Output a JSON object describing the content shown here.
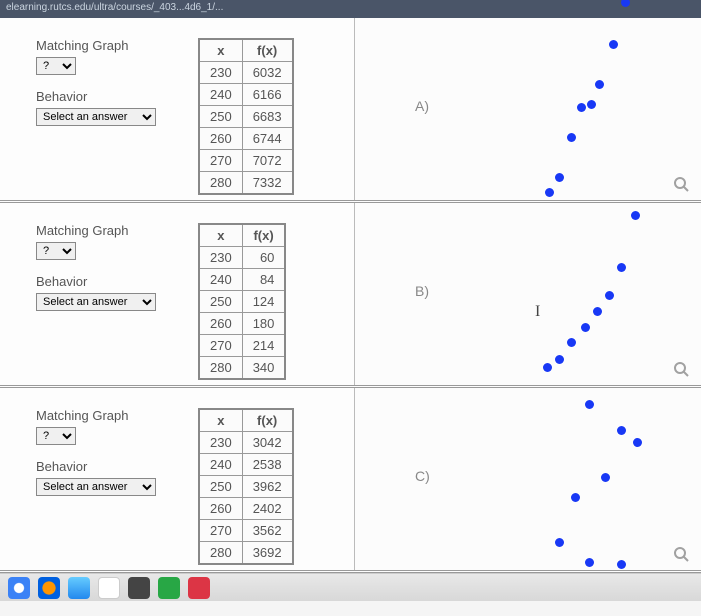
{
  "url_fragment": "elearning.rutcs.edu/ultra/courses/_403...4d6_1/...",
  "labels": {
    "matching_graph": "Matching Graph",
    "behavior": "Behavior",
    "sel_graph_placeholder": "?",
    "sel_behavior_placeholder": "Select an answer"
  },
  "table_headers": {
    "x": "x",
    "fx": "f(x)"
  },
  "rows": [
    {
      "id": "A",
      "graph_label": "A)",
      "data": [
        {
          "x": "230",
          "fx": "6032"
        },
        {
          "x": "240",
          "fx": "6166"
        },
        {
          "x": "250",
          "fx": "6683"
        },
        {
          "x": "260",
          "fx": "6744"
        },
        {
          "x": "270",
          "fx": "7072"
        },
        {
          "x": "280",
          "fx": "7332"
        }
      ],
      "dots": [
        {
          "l": 266,
          "t": -20
        },
        {
          "l": 254,
          "t": 22
        },
        {
          "l": 240,
          "t": 62
        },
        {
          "l": 232,
          "t": 82
        },
        {
          "l": 222,
          "t": 85
        },
        {
          "l": 212,
          "t": 115
        },
        {
          "l": 200,
          "t": 155
        },
        {
          "l": 190,
          "t": 170
        }
      ]
    },
    {
      "id": "B",
      "graph_label": "B)",
      "data": [
        {
          "x": "230",
          "fx": "60"
        },
        {
          "x": "240",
          "fx": "84"
        },
        {
          "x": "250",
          "fx": "124"
        },
        {
          "x": "260",
          "fx": "180"
        },
        {
          "x": "270",
          "fx": "214"
        },
        {
          "x": "280",
          "fx": "340"
        }
      ],
      "dots": [
        {
          "l": 276,
          "t": 8
        },
        {
          "l": 262,
          "t": 60
        },
        {
          "l": 250,
          "t": 88
        },
        {
          "l": 238,
          "t": 104
        },
        {
          "l": 226,
          "t": 120
        },
        {
          "l": 212,
          "t": 135
        },
        {
          "l": 200,
          "t": 152
        },
        {
          "l": 188,
          "t": 160
        }
      ]
    },
    {
      "id": "C",
      "graph_label": "C)",
      "data": [
        {
          "x": "230",
          "fx": "3042"
        },
        {
          "x": "240",
          "fx": "2538"
        },
        {
          "x": "250",
          "fx": "3962"
        },
        {
          "x": "260",
          "fx": "2402"
        },
        {
          "x": "270",
          "fx": "3562"
        },
        {
          "x": "280",
          "fx": "3692"
        }
      ],
      "dots": [
        {
          "l": 278,
          "t": 50
        },
        {
          "l": 262,
          "t": 38
        },
        {
          "l": 246,
          "t": 85
        },
        {
          "l": 230,
          "t": 12
        },
        {
          "l": 216,
          "t": 105
        },
        {
          "l": 200,
          "t": 150
        },
        {
          "l": 230,
          "t": 170
        },
        {
          "l": 262,
          "t": 172
        }
      ]
    }
  ]
}
